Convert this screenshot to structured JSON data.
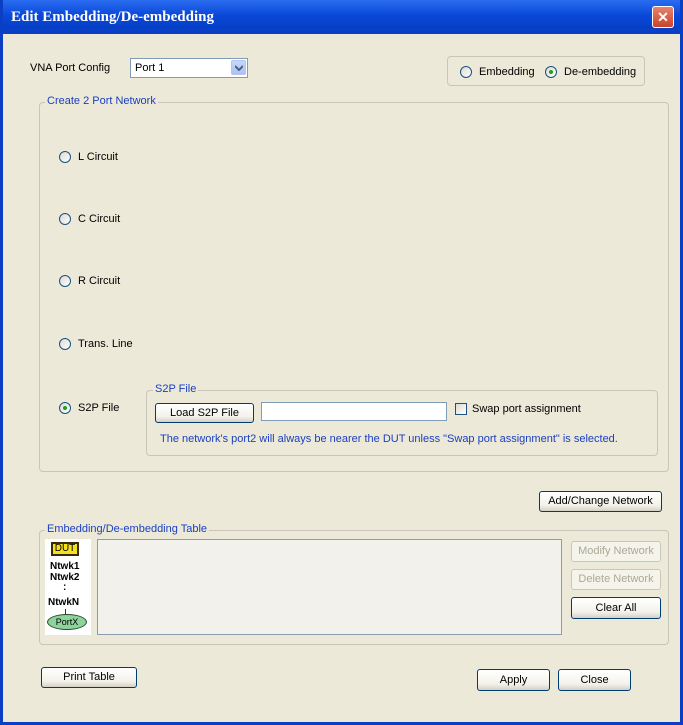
{
  "window": {
    "title": "Edit Embedding/De-embedding",
    "close_glyph": "✕"
  },
  "port_config": {
    "label": "VNA Port Config",
    "value": "Port 1"
  },
  "mode": {
    "embedding": "Embedding",
    "deembedding": "De-embedding",
    "selected": "De-embedding"
  },
  "network_group": {
    "title": "Create 2 Port Network",
    "options": [
      "L Circuit",
      "C Circuit",
      "R Circuit",
      "Trans. Line",
      "S2P File"
    ],
    "selected": "S2P File"
  },
  "s2p": {
    "title": "S2P File",
    "load_button": "Load S2P File",
    "file_value": "",
    "swap_label": "Swap port assignment",
    "swap_checked": false,
    "note": "The network's port2 will always be nearer the DUT unless \"Swap port assignment\" is selected."
  },
  "add_change_button": "Add/Change Network",
  "table": {
    "title": "Embedding/De-embedding Table",
    "diagram": {
      "dut": "DUT",
      "items": [
        "Ntwk1",
        "Ntwk2",
        ":",
        "NtwkN"
      ],
      "port": "PortX"
    },
    "modify_button": "Modify Network",
    "delete_button": "Delete Network",
    "clear_button": "Clear All"
  },
  "footer": {
    "print_button": "Print Table",
    "apply_button": "Apply",
    "close_button": "Close"
  },
  "colors": {
    "titlebar": "#0a48d8",
    "group_label": "#1a3fc0",
    "radio_dot": "#21a121",
    "dut_fill": "#f5e21a",
    "port_fill": "#8fd29c"
  }
}
